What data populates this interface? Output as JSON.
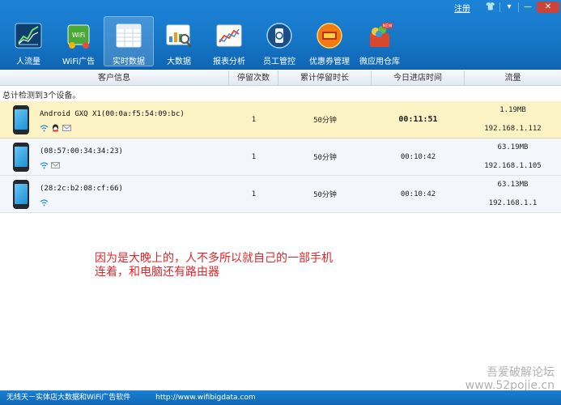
{
  "window": {
    "register_label": "注册",
    "controls": [
      "👕",
      "▾",
      "—",
      "✕"
    ]
  },
  "toolbar": {
    "items": [
      {
        "label": "人流量",
        "icon": "traffic-chart-icon"
      },
      {
        "label": "WiFi广告",
        "icon": "wifi-ad-icon"
      },
      {
        "label": "实时数据",
        "icon": "realtime-data-icon",
        "active": true
      },
      {
        "label": "大数据",
        "icon": "big-data-icon"
      },
      {
        "label": "报表分析",
        "icon": "report-analysis-icon"
      },
      {
        "label": "员工管控",
        "icon": "staff-control-icon"
      },
      {
        "label": "优惠券管理",
        "icon": "coupon-icon"
      },
      {
        "label": "微应用仓库",
        "icon": "app-store-icon"
      }
    ]
  },
  "table": {
    "headers": [
      "客户信息",
      "停留次数",
      "累计停留时长",
      "今日进店时间",
      "流量"
    ],
    "summary": "总计检测到3个设备。",
    "rows": [
      {
        "name": "Android GXQ X1(00:0a:f5:54:09:bc)",
        "stays": "1",
        "duration": "50分钟",
        "entry_time": "00:11:51",
        "traffic": "1.19MB",
        "ip": "192.168.1.112",
        "selected": true,
        "badges": [
          "wifi-signal-icon",
          "qq-icon",
          "mail-icon"
        ]
      },
      {
        "name": "(08:57:00:34:34:23)",
        "stays": "1",
        "duration": "50分钟",
        "entry_time": "00:10:42",
        "traffic": "63.19MB",
        "ip": "192.168.1.105",
        "selected": false,
        "badges": [
          "wifi-signal-icon",
          "mail-icon"
        ]
      },
      {
        "name": "(28:2c:b2:08:cf:66)",
        "stays": "1",
        "duration": "50分钟",
        "entry_time": "00:10:42",
        "traffic": "63.13MB",
        "ip": "192.168.1.1",
        "selected": false,
        "badges": [
          "wifi-signal-icon"
        ]
      }
    ]
  },
  "note": {
    "line1": "因为是大晚上的，人不多所以就自己的一部手机",
    "line2": "连着，和电脑还有路由器"
  },
  "watermark": {
    "line1": "吾爱破解论坛",
    "line2": "www.52pojie.cn"
  },
  "statusbar": {
    "title": "无线天－实体店大数据和WiFi广告软件",
    "url": "http://www.wifibigdata.com"
  }
}
